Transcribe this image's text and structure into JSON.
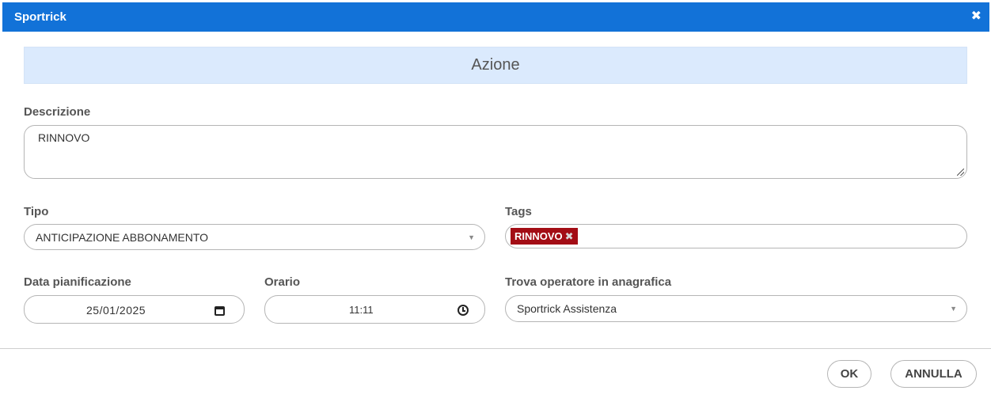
{
  "dialog": {
    "title": "Sportrick",
    "close_icon": "close-icon",
    "colors": {
      "titlebar": "#1272d8",
      "section_header_bg": "#dbeafd",
      "tag_bg": "#a30d15"
    }
  },
  "section": {
    "title": "Azione"
  },
  "descrizione": {
    "label": "Descrizione",
    "value": "RINNOVO"
  },
  "tipo": {
    "label": "Tipo",
    "selected": "ANTICIPAZIONE ABBONAMENTO",
    "arrow": "▼"
  },
  "tags": {
    "label": "Tags",
    "items": [
      {
        "label": "RINNOVO",
        "remove": "✖"
      }
    ]
  },
  "data_pianificazione": {
    "label": "Data pianificazione",
    "value": "25/01/2025",
    "icon": "calendar-icon"
  },
  "orario": {
    "label": "Orario",
    "value": "11:11",
    "icon": "clock-icon"
  },
  "operatore": {
    "label": "Trova operatore in anagrafica",
    "selected": "Sportrick Assistenza",
    "arrow": "▼"
  },
  "buttons": {
    "ok": "OK",
    "annulla": "ANNULLA"
  }
}
